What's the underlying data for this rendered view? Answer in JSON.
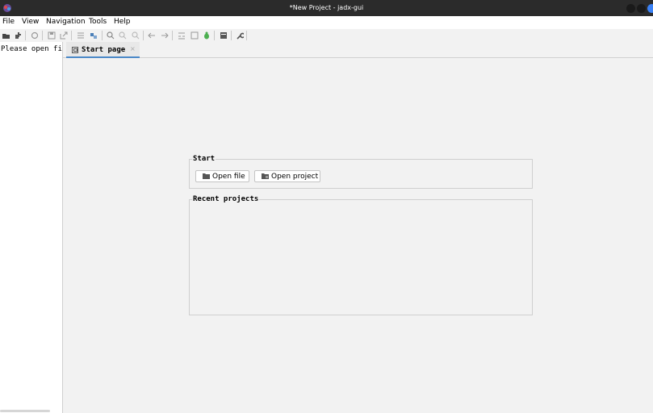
{
  "window": {
    "title": "*New Project - jadx-gui"
  },
  "menubar": {
    "items": [
      "File",
      "View",
      "Navigation",
      "Tools",
      "Help"
    ]
  },
  "toolbar": {
    "icons": [
      "open-file-icon",
      "add-files-icon",
      "reload-icon",
      "save-all-icon",
      "export-icon",
      "sync-tree-icon",
      "flatten-packages-icon",
      "search-icon",
      "class-search-icon",
      "usage-search-icon",
      "back-icon",
      "forward-icon",
      "quark-icon",
      "deobfuscation-icon",
      "debugger-icon",
      "log-viewer-icon",
      "preferences-icon"
    ]
  },
  "left_panel": {
    "hint": "Please open file"
  },
  "tabs": [
    {
      "label": "Start page",
      "close": "×"
    }
  ],
  "start_page": {
    "start_group_title": "Start",
    "open_file_label": "Open file",
    "open_project_label": "Open project",
    "recent_group_title": "Recent projects"
  },
  "colors": {
    "titlebar": "#2b2b2b",
    "tab_accent": "#4a88c7",
    "background": "#f2f2f2"
  }
}
